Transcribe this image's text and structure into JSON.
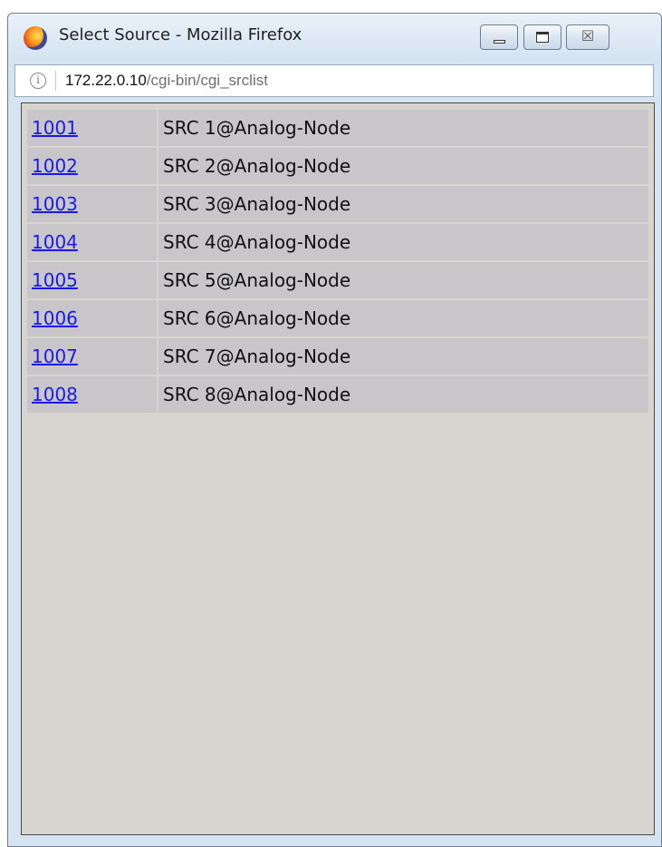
{
  "window": {
    "title": "Select Source - Mozilla Firefox",
    "icon": "firefox-logo",
    "controls": {
      "minimize_icon": "minimize-icon",
      "maximize_icon": "maximize-icon",
      "close_icon": "close-icon",
      "close_glyph": "☒"
    }
  },
  "urlbar": {
    "info_icon_glyph": "i",
    "host": "172.22.0.10",
    "path": "/cgi-bin/cgi_srclist"
  },
  "sources": [
    {
      "id": "1001",
      "name": "SRC 1@Analog-Node"
    },
    {
      "id": "1002",
      "name": "SRC 2@Analog-Node"
    },
    {
      "id": "1003",
      "name": "SRC 3@Analog-Node"
    },
    {
      "id": "1004",
      "name": "SRC 4@Analog-Node"
    },
    {
      "id": "1005",
      "name": "SRC 5@Analog-Node"
    },
    {
      "id": "1006",
      "name": "SRC 6@Analog-Node"
    },
    {
      "id": "1007",
      "name": "SRC 7@Analog-Node"
    },
    {
      "id": "1008",
      "name": "SRC 8@Analog-Node"
    }
  ],
  "colors": {
    "link": "#1a1ae6",
    "row_bg": "#c8c6c9",
    "page_bg": "#d8d5d0",
    "titlebar": "#d6e4f2"
  }
}
